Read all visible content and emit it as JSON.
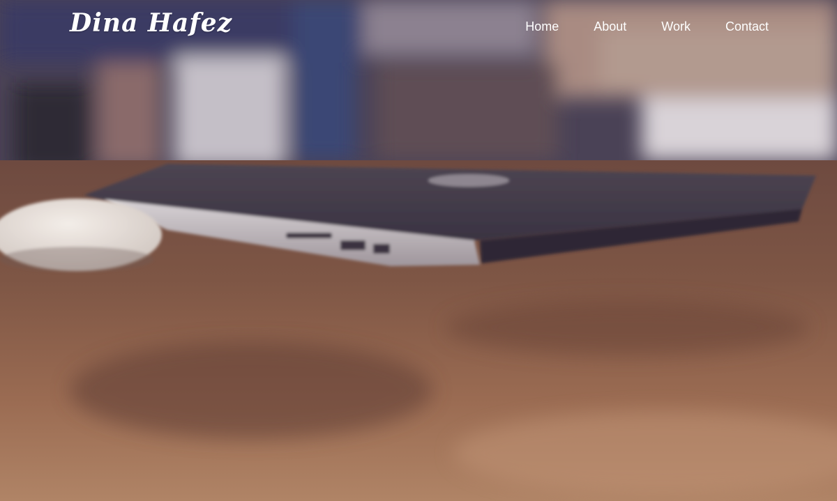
{
  "brand": {
    "name": "Dina Hafez"
  },
  "nav": {
    "items": [
      {
        "label": "Home"
      },
      {
        "label": "About"
      },
      {
        "label": "Work"
      },
      {
        "label": "Contact"
      }
    ]
  },
  "hero": {
    "image": "laptop-and-mouse-on-wooden-desk-photo"
  }
}
